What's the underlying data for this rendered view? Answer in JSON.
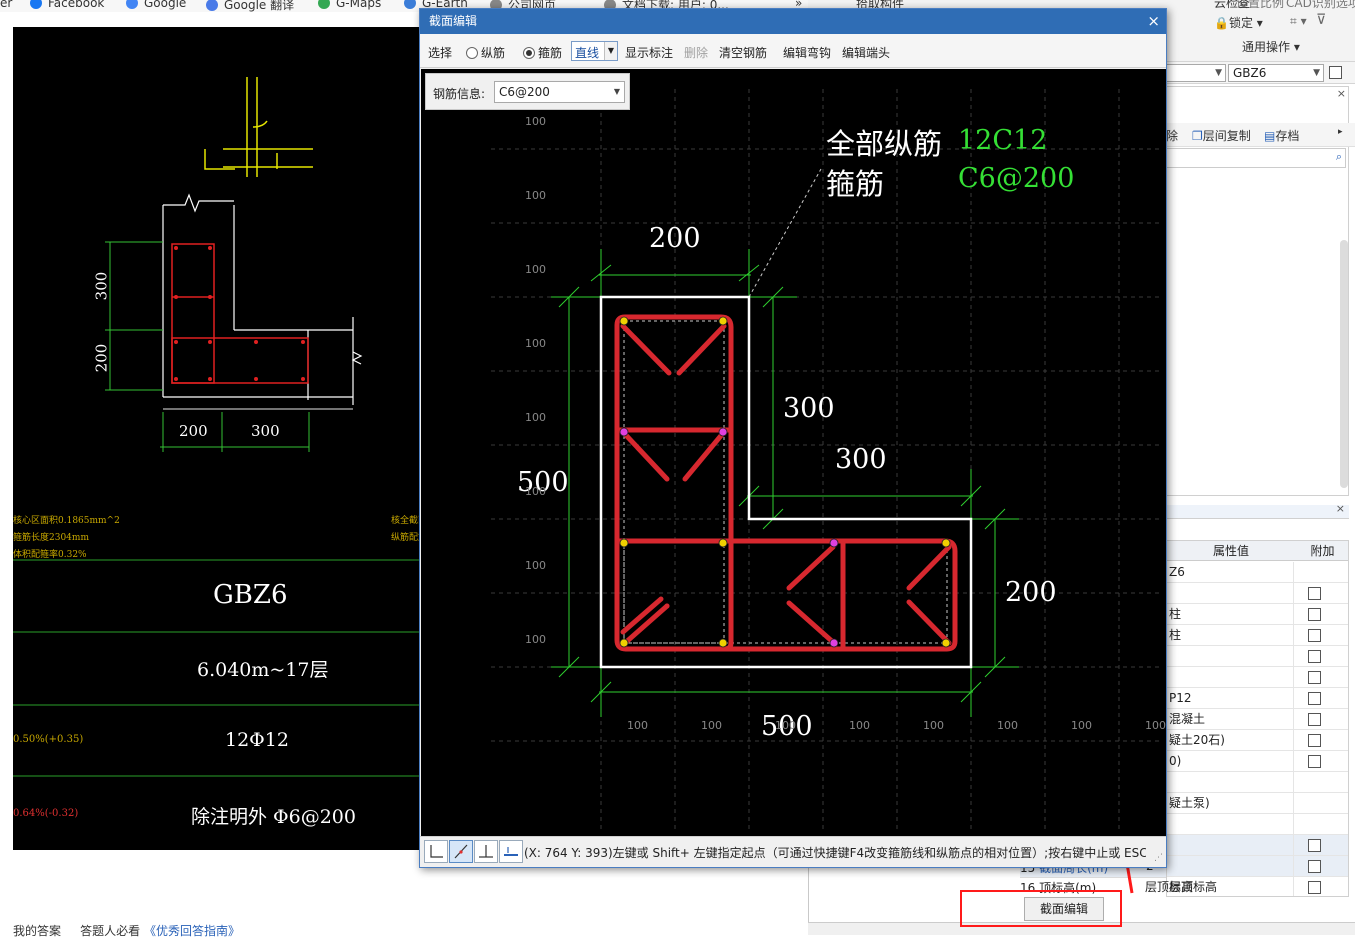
{
  "bookmarks": [
    {
      "label": "er",
      "icon": "none-icon",
      "color": "#ffffff"
    },
    {
      "label": "Facebook",
      "icon": "facebook-icon",
      "color": "#1877f2"
    },
    {
      "label": "Google",
      "icon": "google-icon",
      "color": "#4285f4"
    },
    {
      "label": "Google 翻译",
      "icon": "translate-icon",
      "color": "#4a7be8"
    },
    {
      "label": "G-Maps",
      "icon": "maps-icon",
      "color": "#34a853"
    },
    {
      "label": "G-Earth",
      "icon": "earth-icon",
      "color": "#3b7dd8"
    },
    {
      "label": "公司网页",
      "icon": "globe-icon",
      "color": "#888888"
    },
    {
      "label": "文档下载: 用户: 0...",
      "icon": "doc-icon",
      "color": "#888888"
    }
  ],
  "cad_drawing": {
    "dim_vertical": [
      "300",
      "200"
    ],
    "dim_horizontal": [
      "200",
      "300"
    ],
    "notes": [
      "核心区面积0.1865mm^2",
      "箍筋长度2304mm",
      "体积配箍率0.32%"
    ],
    "notes_right": [
      "核全截面积",
      "纵筋配筋"
    ],
    "table": {
      "name": "GBZ6",
      "elevation": "6.040m~17层",
      "ratio_left": "0.50%(+0.35)",
      "longitudinal": "12Φ12",
      "ratio_left2": "0.64%(-0.32)",
      "stirrup": "除注明外 Φ6@200"
    }
  },
  "below_cad": {
    "text1": "我的答案",
    "text2": "答题人必看",
    "link": "《优秀回答指南》"
  },
  "right_app": {
    "ribbon": {
      "item1": "云检查",
      "item2": "锁定",
      "item3": "通用操作",
      "item0": "设置比例",
      "item4": "CAD识别选项"
    },
    "top_cut": "拾取构件",
    "combo_left": "",
    "combo_right": "GBZ6",
    "tools": [
      "除",
      "层间复制",
      "存档"
    ],
    "prop_headers": [
      "属性值",
      "附加"
    ],
    "prop_rows": [
      {
        "val": "Z6",
        "chk": false
      },
      {
        "val": "",
        "chk": true
      },
      {
        "val": "柱",
        "chk": true
      },
      {
        "val": "柱",
        "chk": true
      },
      {
        "val": "",
        "chk": true
      },
      {
        "val": "",
        "chk": true
      },
      {
        "val": "P12",
        "chk": true
      },
      {
        "val": "混凝土",
        "chk": true
      },
      {
        "val": "疑土20石)",
        "chk": true
      },
      {
        "val": "0)",
        "chk": true
      },
      {
        "val": "",
        "chk": false
      },
      {
        "val": "疑土泵)",
        "chk": false
      },
      {
        "val": "",
        "chk": false
      },
      {
        "val": "",
        "chk": true
      },
      {
        "val": "",
        "chk": true
      },
      {
        "val": "层顶标高",
        "chk": true
      }
    ],
    "bottom_rows": [
      {
        "num": "15",
        "name": "截面周长(m)",
        "val": "2"
      },
      {
        "num": "16",
        "name": "顶标高(m)",
        "val": "层顶标高"
      }
    ],
    "section_edit_label": "截面编辑"
  },
  "dialog": {
    "title": "截面编辑",
    "close": "×",
    "toolbar": {
      "select": "选择",
      "longitudinal": "纵筋",
      "stirrup": "箍筋",
      "line_mode": "直线",
      "show_labels": "显示标注",
      "delete": "删除",
      "clear_rebar": "清空钢筋",
      "edit_bend": "编辑弯钩",
      "edit_end": "编辑端头"
    },
    "rebar_info_label": "钢筋信息:",
    "rebar_info_value": "C6@200",
    "canvas": {
      "label_all_long": "全部纵筋",
      "label_stirrup": "箍筋",
      "value_all_long": "12C12",
      "value_stirrup": "C6@200",
      "dims": {
        "top": "200",
        "right_upper": "300",
        "mid": "300",
        "left": "500",
        "right_lower": "200",
        "bottom": "500"
      },
      "grid_labels": "100",
      "colors": {
        "label_white": "#ffffff",
        "value_green": "#35e035",
        "dim_green": "#2fd02f",
        "rebar_red": "#d7282f",
        "outline": "#ffffff"
      }
    },
    "status_text": "(X: 764 Y: 393)左键或 Shift+ 左键指定起点（可通过快捷键F4改变箍筋线和纵筋点的相对位置）;按右键中止或 ESC 键"
  }
}
